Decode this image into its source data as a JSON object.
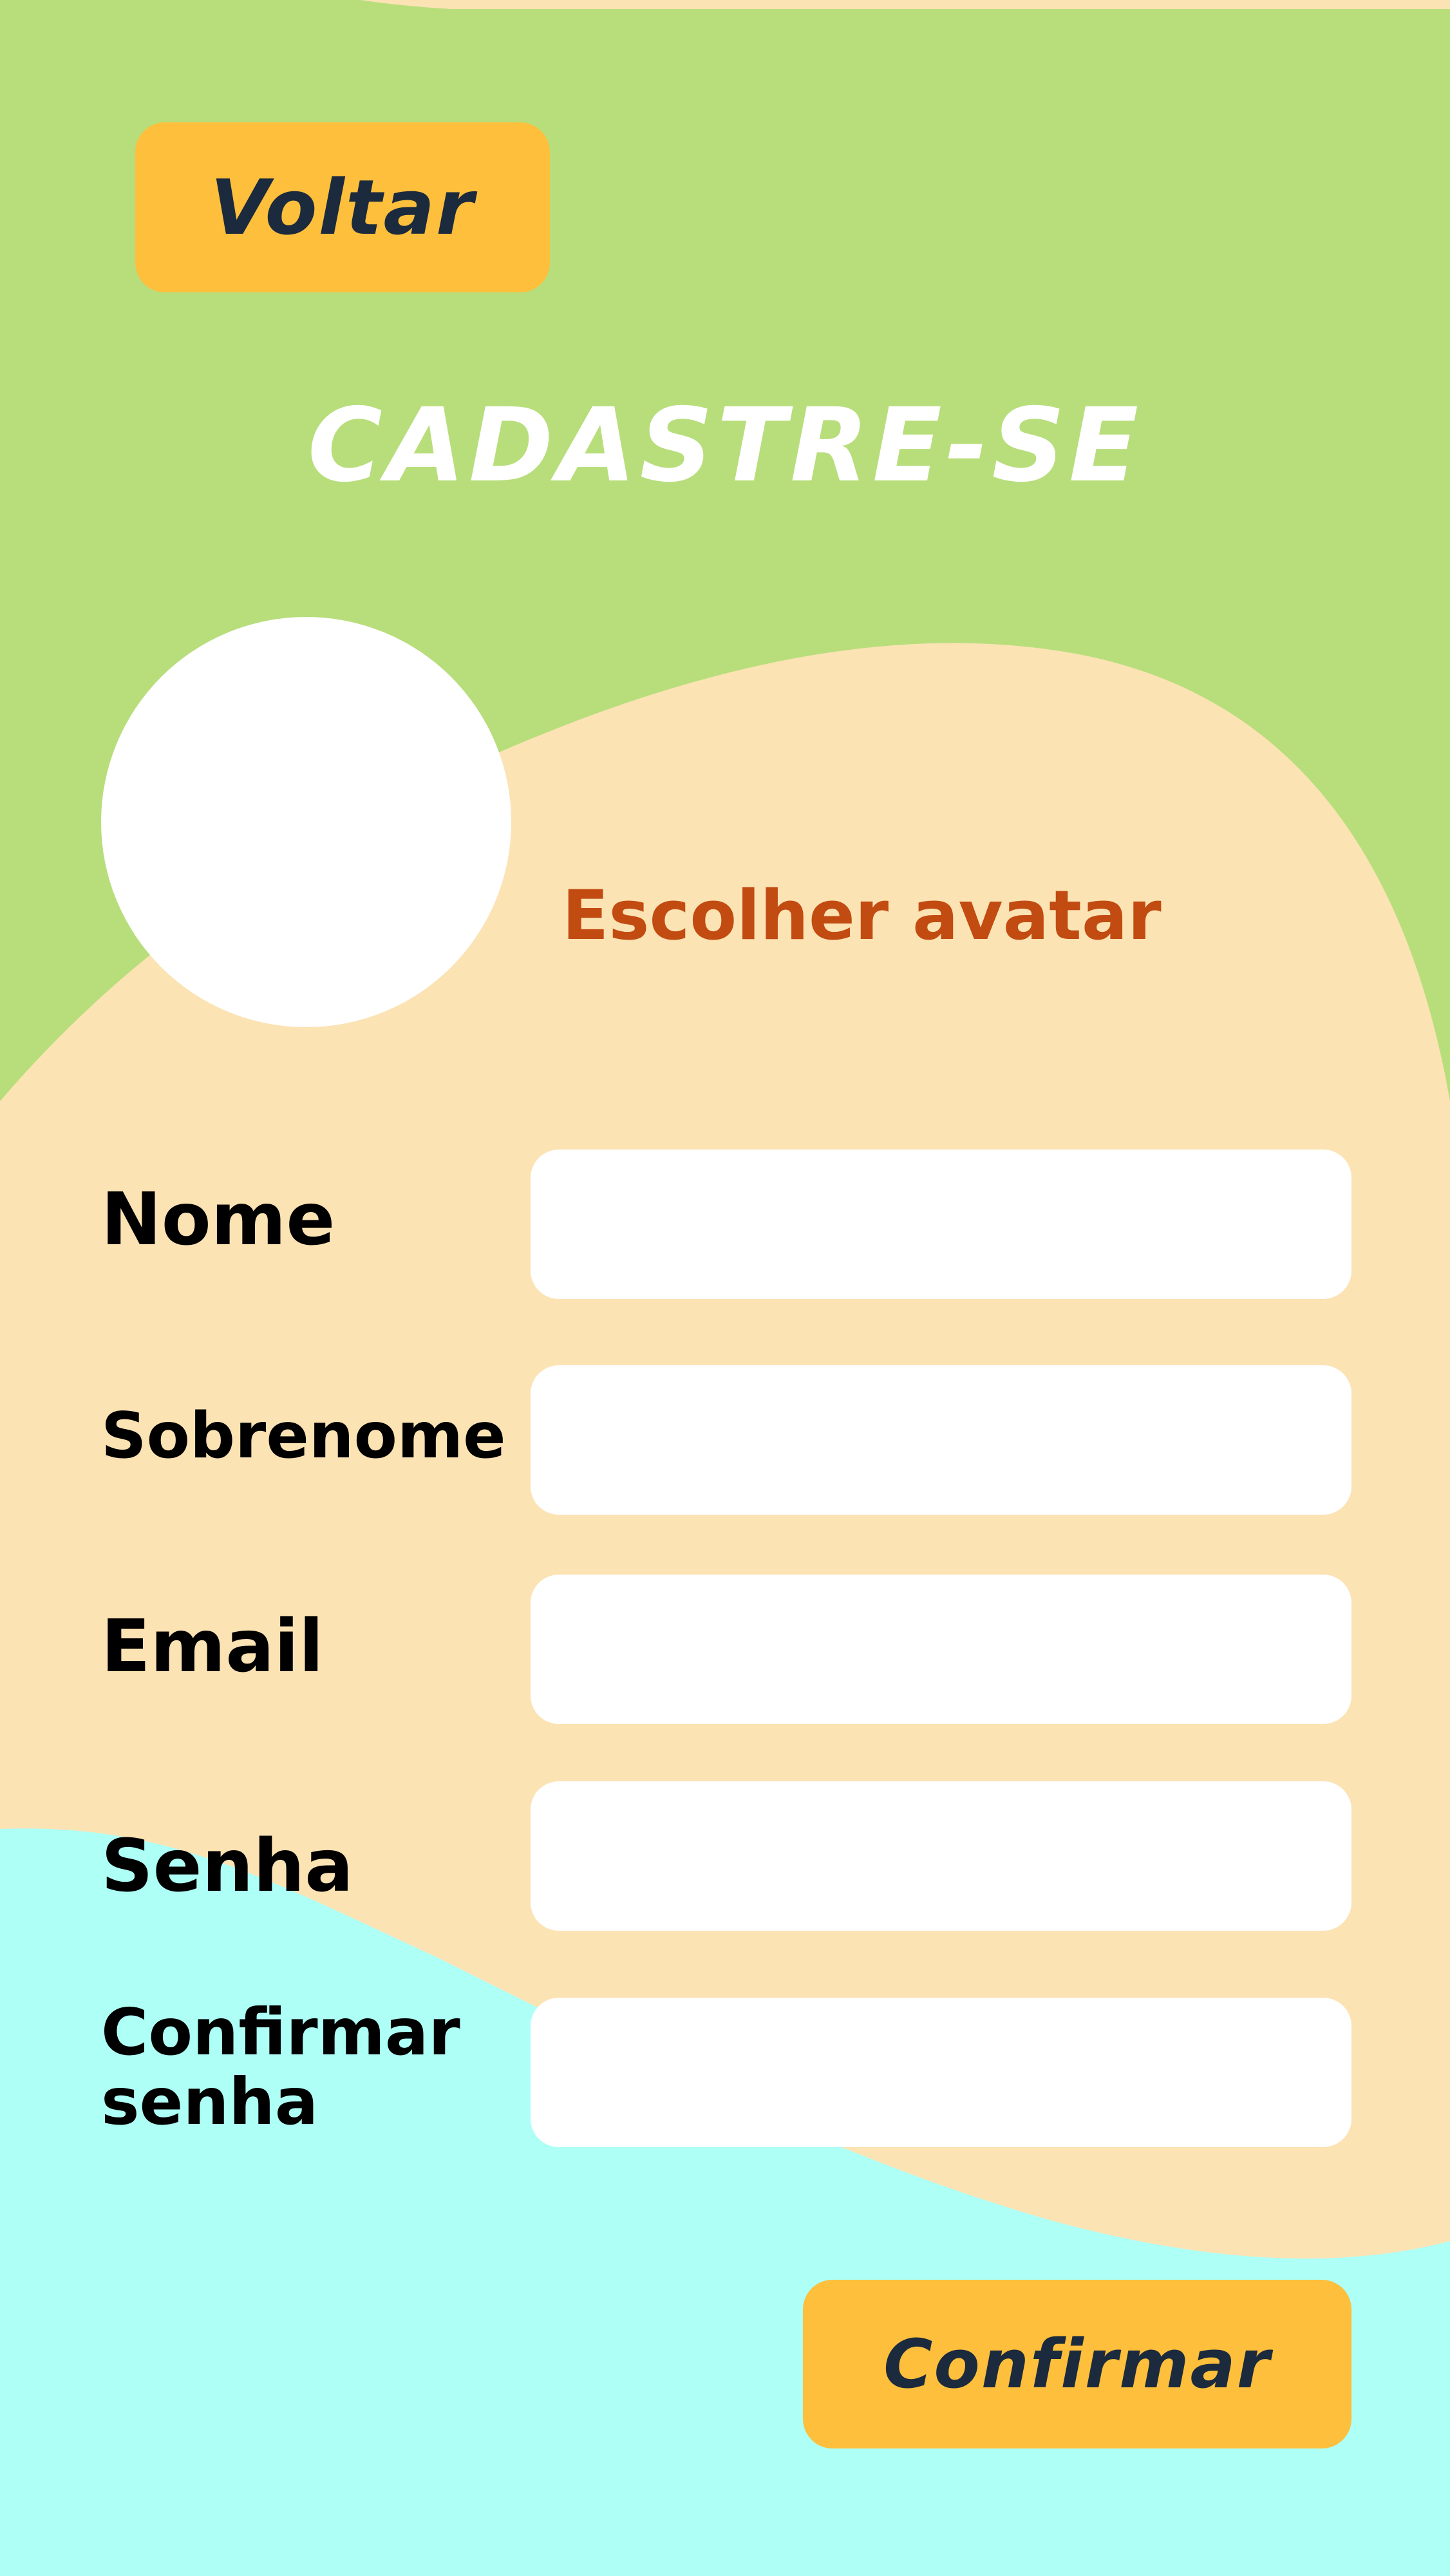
{
  "header": {
    "back_label": "Voltar",
    "title": "CADASTRE-SE"
  },
  "avatar": {
    "choose_label": "Escolher avatar"
  },
  "form": {
    "fields": [
      {
        "label": "Nome",
        "value": ""
      },
      {
        "label": "Sobrenome",
        "value": ""
      },
      {
        "label": "Email",
        "value": ""
      },
      {
        "label": "Senha",
        "value": ""
      },
      {
        "label": "Confirmar senha",
        "value": ""
      }
    ],
    "confirm_label": "Confirmar"
  },
  "colors": {
    "green_background": "#b8de7c",
    "cream_background": "#fce3b4",
    "cyan_background": "#aefff6",
    "button": "#fdbf3c",
    "button_text": "#1b2a3d",
    "accent_link": "#c24b12"
  }
}
